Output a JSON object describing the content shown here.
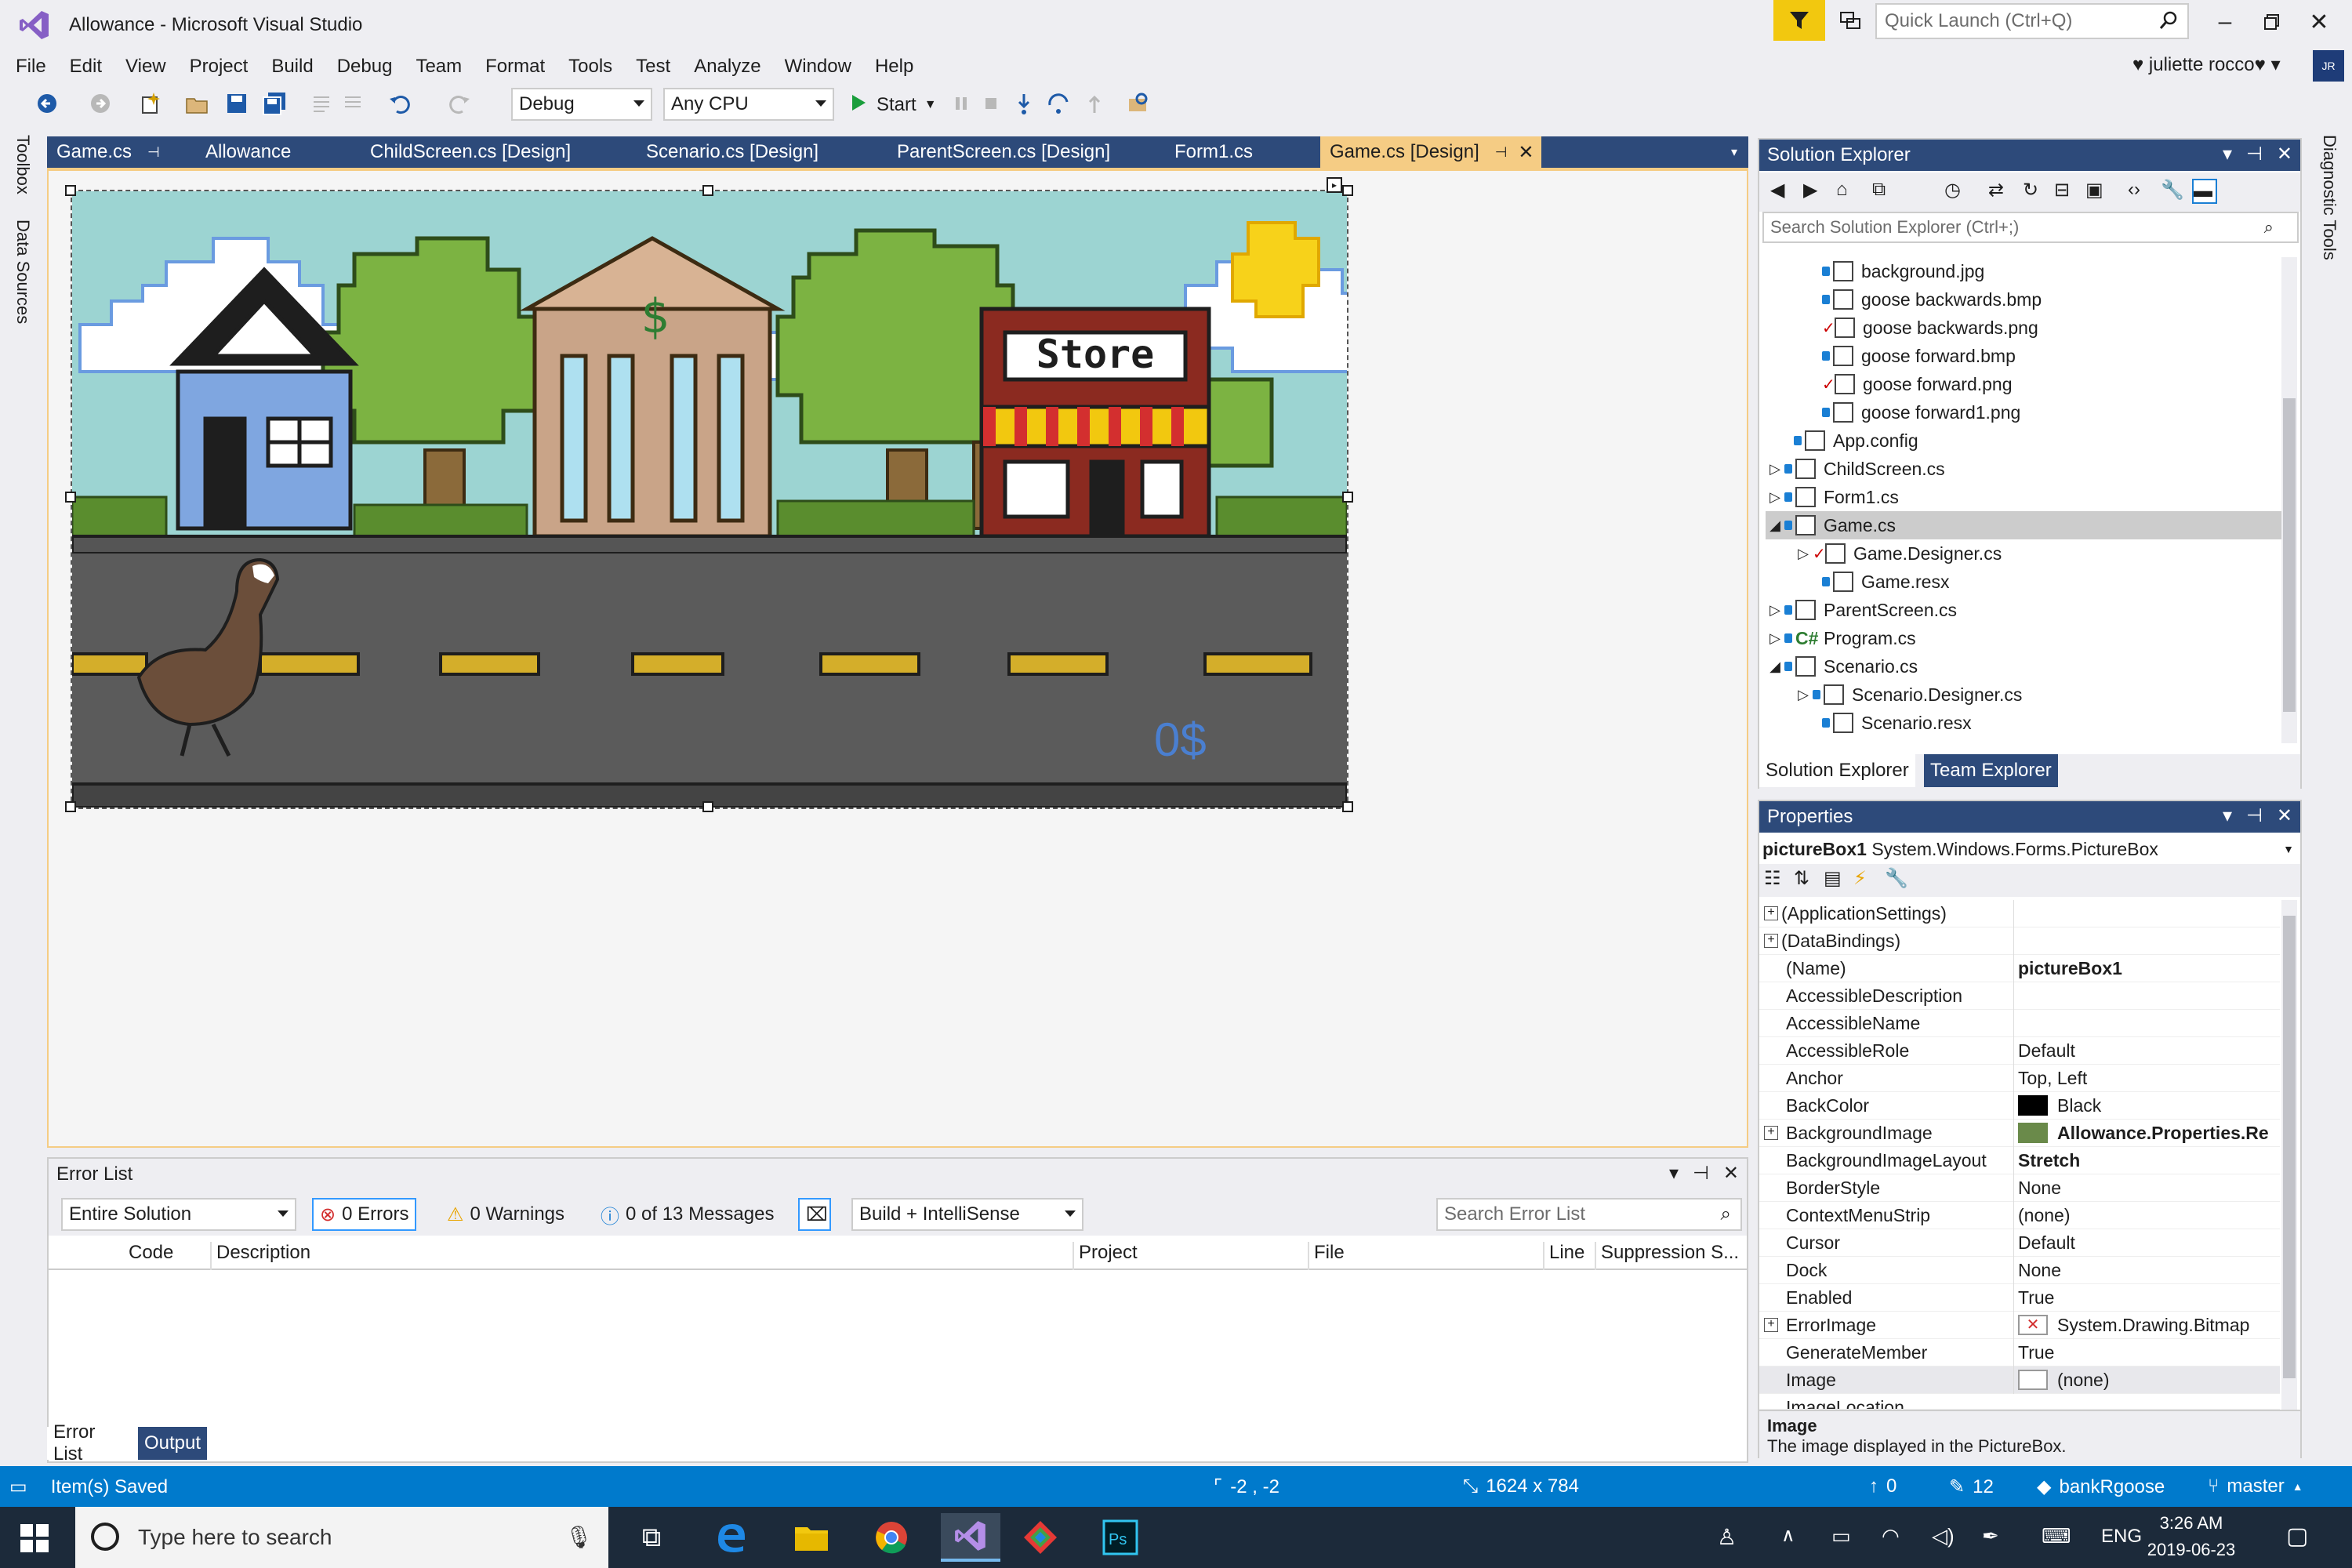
{
  "window": {
    "title": "Allowance - Microsoft Visual Studio",
    "quick_launch_placeholder": "Quick Launch (Ctrl+Q)",
    "user_name": "juliette rocco",
    "user_initials": "JR"
  },
  "menu": [
    "File",
    "Edit",
    "View",
    "Project",
    "Build",
    "Debug",
    "Team",
    "Format",
    "Tools",
    "Test",
    "Analyze",
    "Window",
    "Help"
  ],
  "toolbar": {
    "configuration": "Debug",
    "platform": "Any CPU",
    "start_label": "Start"
  },
  "left_dock": {
    "toolbox": "Toolbox",
    "data_sources": "Data Sources"
  },
  "right_dock": {
    "diagnostic_tools": "Diagnostic Tools"
  },
  "doc_tabs": [
    "Game.cs",
    "Allowance",
    "ChildScreen.cs [Design]",
    "Scenario.cs [Design]",
    "ParentScreen.cs [Design]",
    "Form1.cs",
    "Game.cs [Design]"
  ],
  "game": {
    "money_label": "0$",
    "store_sign": "Store"
  },
  "error_list": {
    "title": "Error List",
    "scope": "Entire Solution",
    "errors": "0 Errors",
    "warnings": "0 Warnings",
    "messages": "0 of 13 Messages",
    "build_filter": "Build + IntelliSense",
    "search_placeholder": "Search Error List",
    "columns": [
      "Code",
      "Description",
      "Project",
      "File",
      "Line",
      "Suppression S..."
    ],
    "bottom_tabs": [
      "Error List",
      "Output"
    ]
  },
  "solution_explorer": {
    "title": "Solution Explorer",
    "search_placeholder": "Search Solution Explorer (Ctrl+;)",
    "items": [
      {
        "label": "background.jpg"
      },
      {
        "label": "goose backwards.bmp"
      },
      {
        "label": "goose backwards.png"
      },
      {
        "label": "goose forward.bmp"
      },
      {
        "label": "goose forward.png"
      },
      {
        "label": "goose forward1.png"
      },
      {
        "label": "App.config"
      },
      {
        "label": "ChildScreen.cs"
      },
      {
        "label": "Form1.cs"
      },
      {
        "label": "Game.cs"
      },
      {
        "label": "Game.Designer.cs"
      },
      {
        "label": "Game.resx"
      },
      {
        "label": "ParentScreen.cs"
      },
      {
        "label": "Program.cs"
      },
      {
        "label": "Scenario.cs"
      },
      {
        "label": "Scenario.Designer.cs"
      },
      {
        "label": "Scenario.resx"
      }
    ],
    "tabs": [
      "Solution Explorer",
      "Team Explorer"
    ]
  },
  "properties": {
    "title": "Properties",
    "object_name": "pictureBox1",
    "object_type": "System.Windows.Forms.PictureBox",
    "rows": [
      {
        "name": "(ApplicationSettings)",
        "value": ""
      },
      {
        "name": "(DataBindings)",
        "value": ""
      },
      {
        "name": "(Name)",
        "value": "pictureBox1"
      },
      {
        "name": "AccessibleDescription",
        "value": ""
      },
      {
        "name": "AccessibleName",
        "value": ""
      },
      {
        "name": "AccessibleRole",
        "value": "Default"
      },
      {
        "name": "Anchor",
        "value": "Top, Left"
      },
      {
        "name": "BackColor",
        "value": "Black"
      },
      {
        "name": "BackgroundImage",
        "value": "Allowance.Properties.Re"
      },
      {
        "name": "BackgroundImageLayout",
        "value": "Stretch"
      },
      {
        "name": "BorderStyle",
        "value": "None"
      },
      {
        "name": "ContextMenuStrip",
        "value": "(none)"
      },
      {
        "name": "Cursor",
        "value": "Default"
      },
      {
        "name": "Dock",
        "value": "None"
      },
      {
        "name": "Enabled",
        "value": "True"
      },
      {
        "name": "ErrorImage",
        "value": "System.Drawing.Bitmap"
      },
      {
        "name": "GenerateMember",
        "value": "True"
      },
      {
        "name": "Image",
        "value": "(none)"
      },
      {
        "name": "ImageLocation",
        "value": ""
      }
    ],
    "desc_title": "Image",
    "desc_text": "The image displayed in the PictureBox."
  },
  "status_bar": {
    "message": "Item(s) Saved",
    "position": "-2 , -2",
    "size": "1624 x 784",
    "up_count": "0",
    "pencil_count": "12",
    "repo": "bankRgoose",
    "branch": "master"
  },
  "taskbar": {
    "search_placeholder": "Type here to search",
    "language": "ENG",
    "time": "3:26 AM",
    "date": "2019-06-23"
  },
  "colors": {
    "accent": "#007acc",
    "tab_bar": "#2d4a7a",
    "active_tab": "#f5cc84",
    "filter": "#f2c80f"
  }
}
